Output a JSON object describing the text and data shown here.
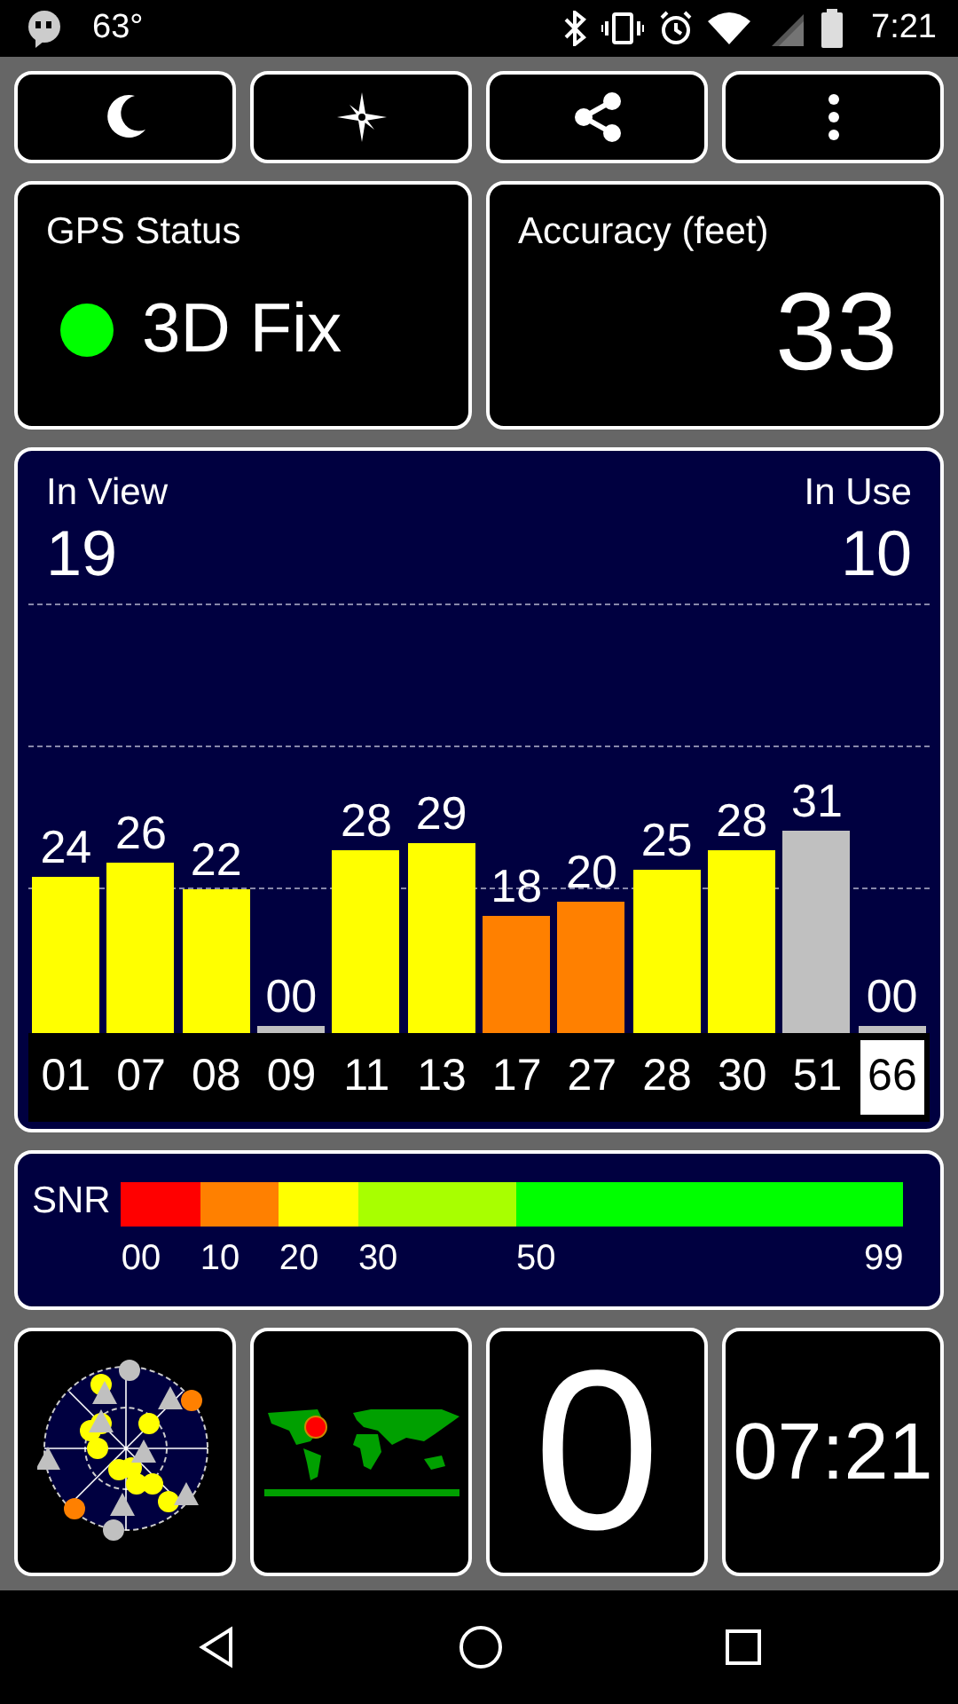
{
  "status_bar": {
    "temperature": "63°",
    "time": "7:21"
  },
  "toolbar": [
    {
      "kind": "moon"
    },
    {
      "kind": "compass"
    },
    {
      "kind": "share"
    },
    {
      "kind": "more"
    }
  ],
  "gps_status": {
    "title": "GPS Status",
    "value": "3D Fix",
    "color": "#00ff00"
  },
  "accuracy": {
    "title": "Accuracy (feet)",
    "value": "33"
  },
  "satellites": {
    "in_view_label": "In View",
    "in_view": "19",
    "in_use_label": "In Use",
    "in_use": "10",
    "bars": [
      {
        "id": "01",
        "snr": "24",
        "color": "#ffff00",
        "selected": false
      },
      {
        "id": "07",
        "snr": "26",
        "color": "#ffff00",
        "selected": false
      },
      {
        "id": "08",
        "snr": "22",
        "color": "#ffff00",
        "selected": false
      },
      {
        "id": "09",
        "snr": "00",
        "color": "#c0c0c0",
        "selected": false
      },
      {
        "id": "11",
        "snr": "28",
        "color": "#ffff00",
        "selected": false
      },
      {
        "id": "13",
        "snr": "29",
        "color": "#ffff00",
        "selected": false
      },
      {
        "id": "17",
        "snr": "18",
        "color": "#ff8000",
        "selected": false
      },
      {
        "id": "27",
        "snr": "20",
        "color": "#ff8000",
        "selected": false
      },
      {
        "id": "28",
        "snr": "25",
        "color": "#ffff00",
        "selected": false
      },
      {
        "id": "30",
        "snr": "28",
        "color": "#ffff00",
        "selected": false
      },
      {
        "id": "51",
        "snr": "31",
        "color": "#c0c0c0",
        "selected": false
      },
      {
        "id": "66",
        "snr": "00",
        "color": "#c0c0c0",
        "selected": true
      }
    ]
  },
  "snr_scale": {
    "title": "SNR",
    "segments": [
      {
        "label": "00",
        "color": "#ff0000"
      },
      {
        "label": "10",
        "color": "#ff8000"
      },
      {
        "label": "20",
        "color": "#ffff00"
      },
      {
        "label": "30",
        "color": "#a8ff00"
      },
      {
        "label": "50",
        "color": "#00ff00"
      }
    ],
    "end_label": "99"
  },
  "tiles": {
    "speed": "0",
    "clock": "07:21"
  }
}
